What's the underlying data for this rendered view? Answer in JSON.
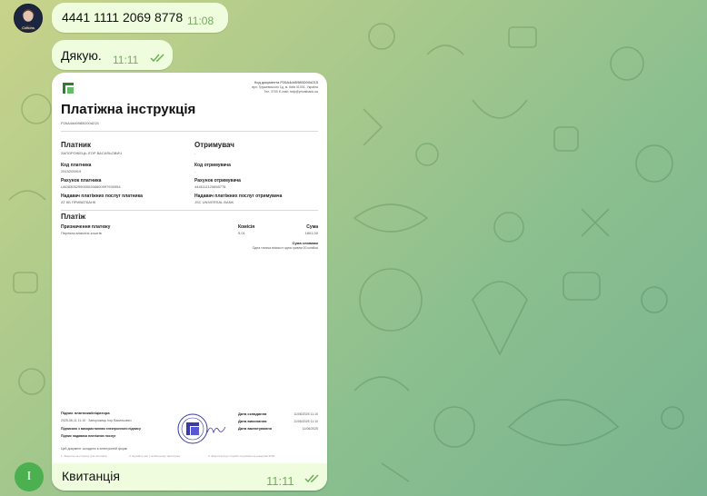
{
  "colors": {
    "bubble": "#effdde",
    "time": "#6fae5a",
    "accent_green": "#4caf50",
    "bank_green": "#2e7d32",
    "stamp_blue": "#3a3aa8"
  },
  "chat": {
    "first_msg": {
      "text": "4441 1111 2069 8778",
      "time": "11:08",
      "avatar_label": "Cottons"
    },
    "second_msg": {
      "text": "Дякую.",
      "time": "11:11"
    },
    "last_msg": {
      "text": "Квитанція",
      "time": "11:11",
      "avatar_letter": "I"
    }
  },
  "doc": {
    "header_code": "Код документа P26A4dd0985D00d215",
    "header_sub1": "вул. Грушевського 1д, м. Київ 01001, Україна",
    "header_sub2": "Тел. 3700 E-mail: help@privatbank.ua",
    "title": "Платіжна інструкція",
    "ref": "P26A4dd0985D00d215",
    "payer_heading": "Платник",
    "payer_name": "ЗАПОРОЖЕЦЬ ІГОР ВАСИЛЬОВИЧ",
    "recipient_heading": "Отримувач",
    "recipient_name": "-",
    "payer_code_label": "Код платника",
    "payer_code": "2515205919",
    "recipient_code_label": "Код отримувача",
    "recipient_code": "-",
    "payer_acc_label": "Рахунок платника",
    "payer_acc": "UA083052990000266600997930954",
    "recipient_acc_label": "Рахунок отримувача",
    "recipient_acc": "4441111120698778",
    "payer_bank_label": "Надавач платіжних послуг платника",
    "payer_bank": "АТ КБ ПРИВАТБАНК",
    "recipient_bank_label": "Надавач платіжних послуг отримувача",
    "recipient_bank": "JSC UNIVERSAL BANK",
    "payment_heading": "Платіж",
    "purpose_label": "Призначення платежу",
    "purpose": "Переказ власних коштів",
    "fee_label": "Комісія",
    "fee": "9,01",
    "amount_label": "Сума",
    "amount": "1801,00",
    "words_label": "Сума словами",
    "words": "Одна тисяча вісімсот одна гривня 00 копійок",
    "sign_label": "Підпис платника/ініціатора",
    "signer": "2025-06-11 11:10 · Запорожець Ігор Васильович",
    "sign_note1": "Підписано з використанням електронного підпису",
    "sign_note2": "Підпис надавача платіжних послуг",
    "date_created_label": "Дата складання",
    "date_created": "11/06/2025 11:10",
    "date_done_label": "Дата виконання",
    "date_done": "11/06/2025 11:10",
    "date_val_label": "Дата валютування",
    "date_val": "11/06/2025",
    "footer1": "Цей документ складено в електронній формі",
    "footer_a": "1. Зверніть на сторону для контактів",
    "footer_b": "2. Шукайте нас у мобільному застосунку",
    "footer_c": "3. Зверніться до служби підтримки за номером 3700"
  }
}
